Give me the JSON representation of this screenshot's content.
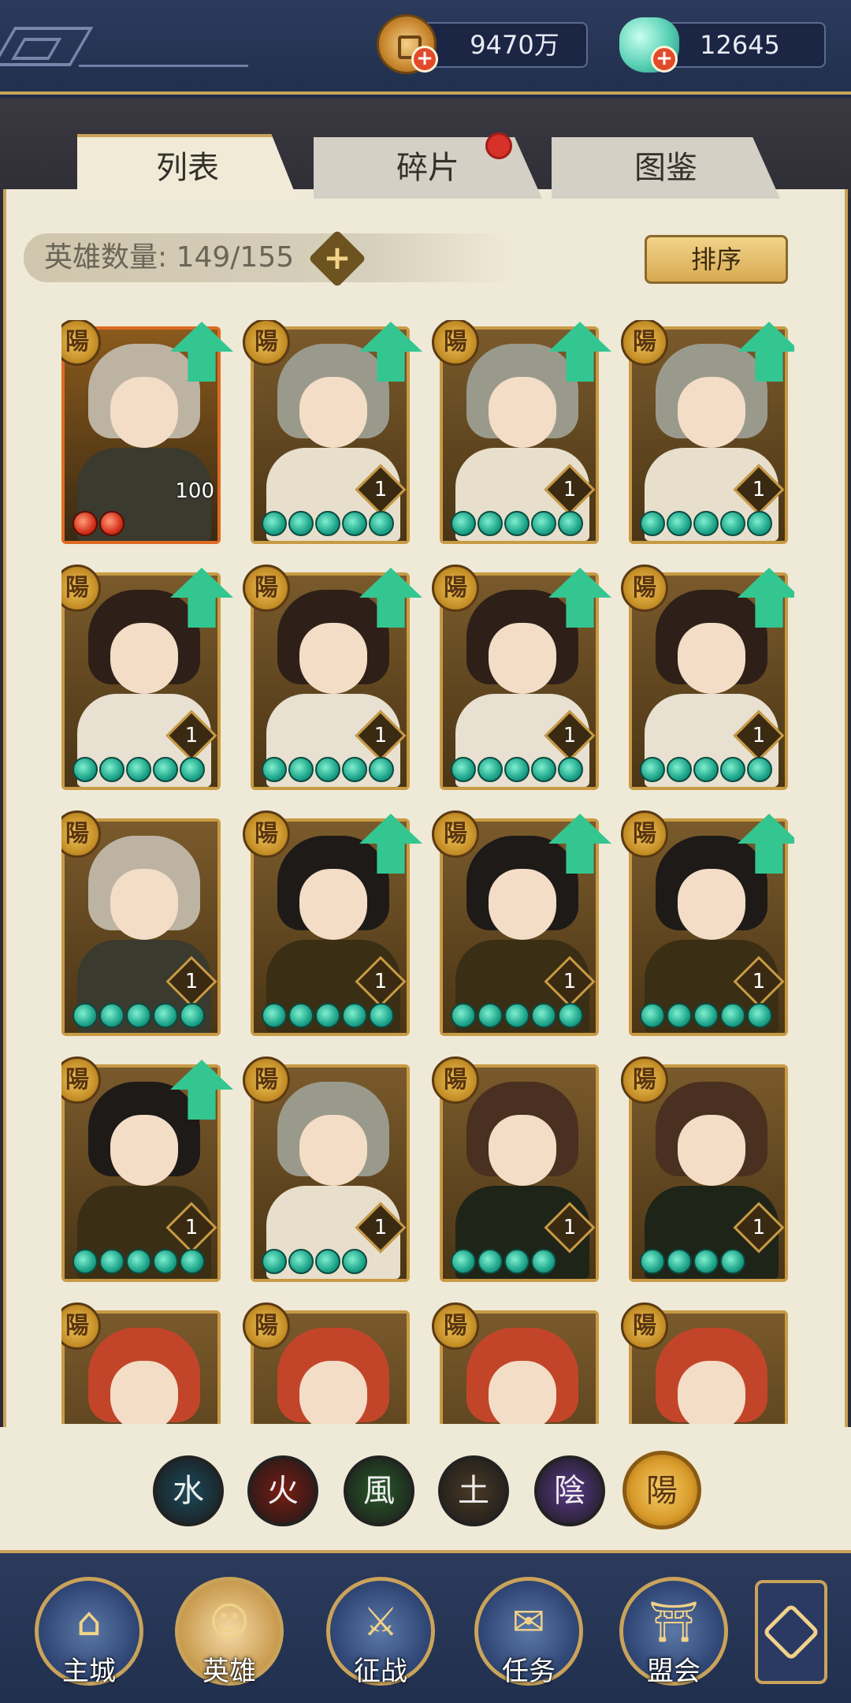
{
  "resources": {
    "coins": "9470万",
    "jade": "12645"
  },
  "tabs": [
    {
      "label": "列表",
      "active": true
    },
    {
      "label": "碎片",
      "active": false,
      "badge": true
    },
    {
      "label": "图鉴",
      "active": false
    }
  ],
  "hero_count": {
    "label": "英雄数量",
    "value": "149/155"
  },
  "sort_button": "排序",
  "element_symbol": "陽",
  "heroes": [
    {
      "name": "hero-silver-hair",
      "level": "100",
      "stars": 2,
      "star_color": "red",
      "upgrade": true,
      "red_frame": true
    },
    {
      "name": "hero-grey-hair",
      "level": "1",
      "stars": 5,
      "star_color": "green",
      "upgrade": true
    },
    {
      "name": "hero-grey-hair",
      "level": "1",
      "stars": 5,
      "star_color": "green",
      "upgrade": true
    },
    {
      "name": "hero-grey-hair",
      "level": "1",
      "stars": 5,
      "star_color": "green",
      "upgrade": true
    },
    {
      "name": "hero-dark-hair-female",
      "level": "1",
      "stars": 5,
      "star_color": "green",
      "upgrade": true
    },
    {
      "name": "hero-dark-hair-female",
      "level": "1",
      "stars": 5,
      "star_color": "green",
      "upgrade": true
    },
    {
      "name": "hero-dark-hair-female",
      "level": "1",
      "stars": 5,
      "star_color": "green",
      "upgrade": true
    },
    {
      "name": "hero-dark-hair-female",
      "level": "1",
      "stars": 5,
      "star_color": "green",
      "upgrade": true
    },
    {
      "name": "hero-silver-hair",
      "level": "1",
      "stars": 5,
      "star_color": "green",
      "upgrade": false
    },
    {
      "name": "hero-yellow-ribbon",
      "level": "1",
      "stars": 5,
      "star_color": "green",
      "upgrade": true
    },
    {
      "name": "hero-yellow-ribbon",
      "level": "1",
      "stars": 5,
      "star_color": "green",
      "upgrade": true
    },
    {
      "name": "hero-yellow-ribbon",
      "level": "1",
      "stars": 5,
      "star_color": "green",
      "upgrade": true
    },
    {
      "name": "hero-yellow-ribbon",
      "level": "1",
      "stars": 5,
      "star_color": "green",
      "upgrade": true
    },
    {
      "name": "hero-grey-hair",
      "level": "1",
      "stars": 4,
      "star_color": "green",
      "upgrade": false
    },
    {
      "name": "hero-brown-hair-male",
      "level": "1",
      "stars": 4,
      "star_color": "green",
      "upgrade": false
    },
    {
      "name": "hero-brown-hair-male",
      "level": "1",
      "stars": 4,
      "star_color": "green",
      "upgrade": false
    },
    {
      "name": "hero-red-hair",
      "level": "",
      "stars": 0,
      "star_color": "green",
      "upgrade": false
    },
    {
      "name": "hero-red-hair",
      "level": "",
      "stars": 0,
      "star_color": "green",
      "upgrade": false
    },
    {
      "name": "hero-red-hair",
      "level": "",
      "stars": 0,
      "star_color": "green",
      "upgrade": false
    },
    {
      "name": "hero-red-hair",
      "level": "",
      "stars": 0,
      "star_color": "green",
      "upgrade": false
    }
  ],
  "element_filters": [
    {
      "glyph": "水",
      "name": "water",
      "color": "#1c4a5a"
    },
    {
      "glyph": "火",
      "name": "fire",
      "color": "#7a1c12"
    },
    {
      "glyph": "風",
      "name": "wind",
      "color": "#2a5a2a"
    },
    {
      "glyph": "土",
      "name": "earth",
      "color": "#4a3a26"
    },
    {
      "glyph": "陰",
      "name": "yin",
      "color": "#5a3a8a"
    },
    {
      "glyph": "陽",
      "name": "yang",
      "color": "#d89a2a",
      "active": true
    }
  ],
  "nav": [
    {
      "label": "主城",
      "name": "main-city",
      "active": false
    },
    {
      "label": "英雄",
      "name": "heroes",
      "active": true
    },
    {
      "label": "征战",
      "name": "campaign",
      "active": false
    },
    {
      "label": "任务",
      "name": "quests",
      "active": false
    },
    {
      "label": "盟会",
      "name": "alliance",
      "active": false
    }
  ]
}
